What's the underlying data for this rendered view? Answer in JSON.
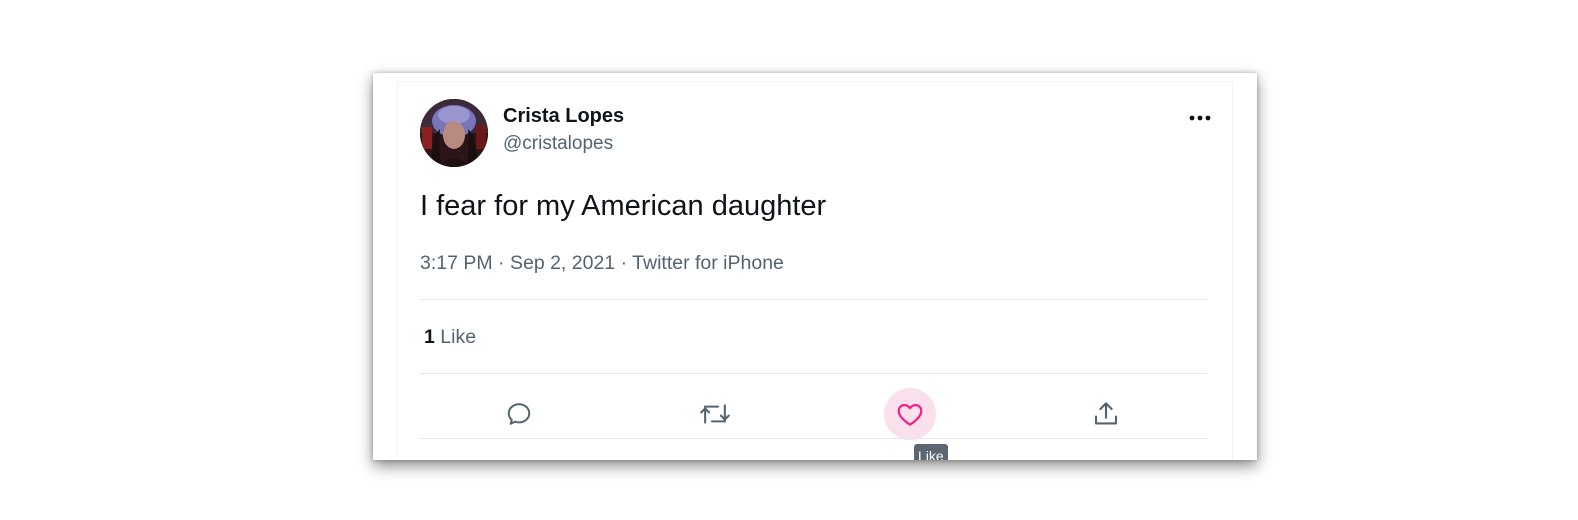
{
  "tweet": {
    "author": {
      "display_name": "Crista Lopes",
      "handle": "@cristalopes"
    },
    "text": "I fear for my American daughter",
    "meta": {
      "time": "3:17 PM",
      "date": "Sep 2, 2021",
      "source": "Twitter for iPhone",
      "separator": "·"
    },
    "stats": {
      "likes_count": "1",
      "likes_label": "Like"
    },
    "actions": {
      "reply_icon": "reply-icon",
      "retweet_icon": "retweet-icon",
      "like_icon": "heart-icon",
      "share_icon": "share-icon",
      "more_icon": "more-horizontal-icon"
    },
    "tooltip": "Like"
  },
  "colors": {
    "text_primary": "#0f1419",
    "text_secondary": "#536471",
    "like_pink": "#f91880",
    "like_hover_bg": "#fae0ec",
    "tooltip_bg": "#5b6670",
    "divider": "#e4e9ec"
  }
}
